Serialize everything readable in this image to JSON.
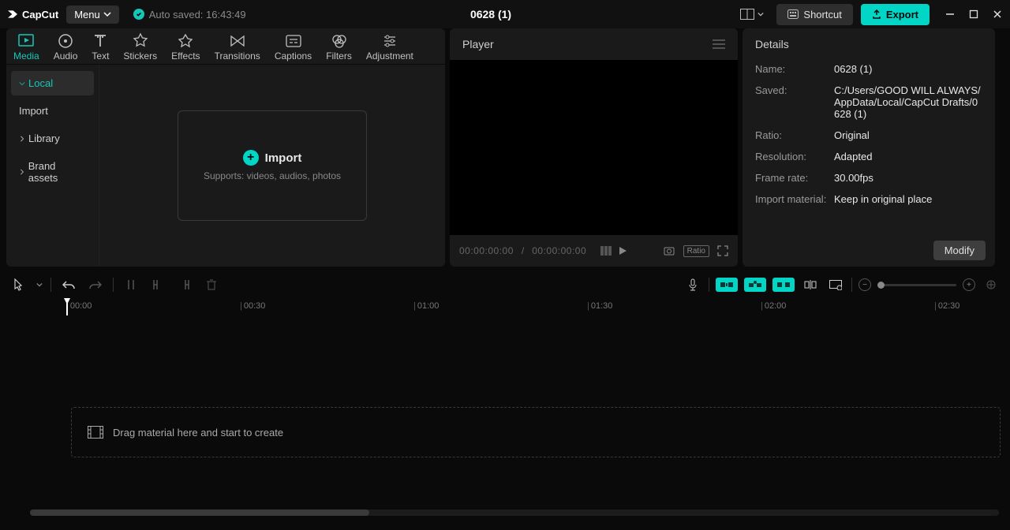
{
  "app": {
    "name": "CapCut",
    "menu_label": "Menu",
    "autosave": "Auto saved: 16:43:49",
    "project_title": "0628 (1)",
    "shortcut_label": "Shortcut",
    "export_label": "Export"
  },
  "tabs": [
    {
      "id": "media",
      "label": "Media"
    },
    {
      "id": "audio",
      "label": "Audio"
    },
    {
      "id": "text",
      "label": "Text"
    },
    {
      "id": "stickers",
      "label": "Stickers"
    },
    {
      "id": "effects",
      "label": "Effects"
    },
    {
      "id": "transitions",
      "label": "Transitions"
    },
    {
      "id": "captions",
      "label": "Captions"
    },
    {
      "id": "filters",
      "label": "Filters"
    },
    {
      "id": "adjustment",
      "label": "Adjustment"
    }
  ],
  "sidebar": [
    {
      "label": "Local",
      "selected": true,
      "chev": "down"
    },
    {
      "label": "Import",
      "selected": false,
      "chev": ""
    },
    {
      "label": "Library",
      "selected": false,
      "chev": "right"
    },
    {
      "label": "Brand assets",
      "selected": false,
      "chev": "right"
    }
  ],
  "import_box": {
    "label": "Import",
    "sub": "Supports: videos, audios, photos"
  },
  "player": {
    "title": "Player",
    "time_current": "00:00:00:00",
    "time_total": "00:00:00:00",
    "ratio_label": "Ratio"
  },
  "details": {
    "title": "Details",
    "name_label": "Name:",
    "name_value": "0628 (1)",
    "saved_label": "Saved:",
    "saved_value": "C:/Users/GOOD WILL ALWAYS/AppData/Local/CapCut Drafts/0628 (1)",
    "ratio_label": "Ratio:",
    "ratio_value": "Original",
    "res_label": "Resolution:",
    "res_value": "Adapted",
    "fps_label": "Frame rate:",
    "fps_value": "30.00fps",
    "import_label": "Import material:",
    "import_value": "Keep in original place",
    "modify_label": "Modify"
  },
  "timeline": {
    "drop_hint": "Drag material here and start to create",
    "marks": [
      "00:00",
      "00:30",
      "01:00",
      "01:30",
      "02:00",
      "02:30"
    ]
  }
}
